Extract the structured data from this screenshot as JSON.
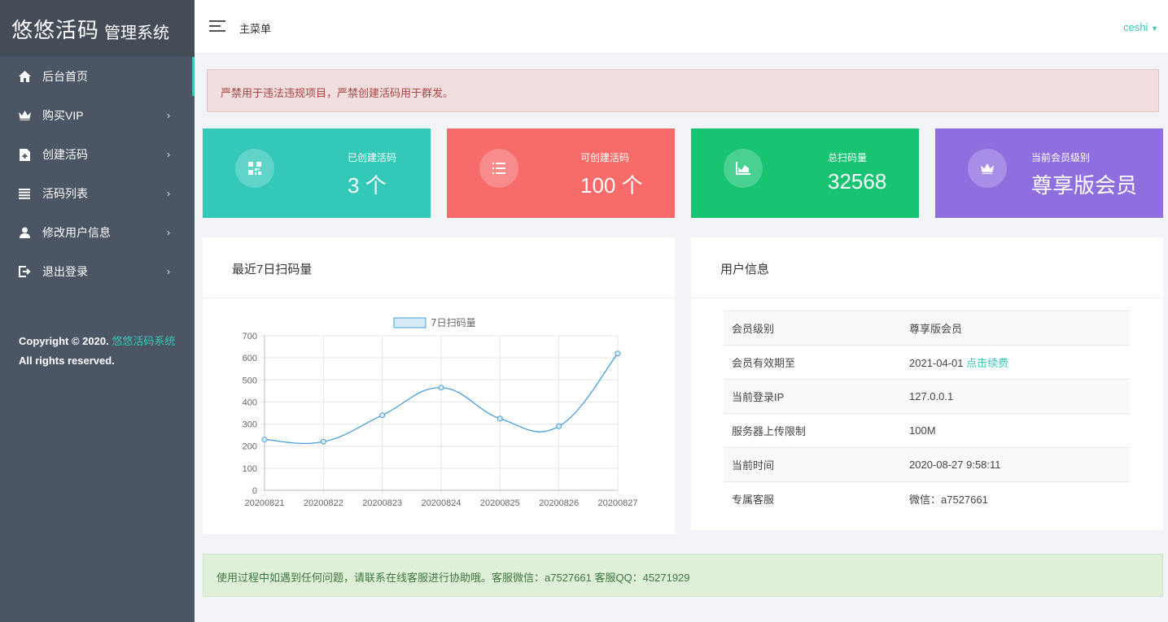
{
  "brand": {
    "name": "悠悠活码",
    "suffix": "管理系统"
  },
  "sidebar": {
    "items": [
      {
        "label": "后台首页",
        "icon": "home-icon"
      },
      {
        "label": "购买VIP",
        "icon": "crown-icon"
      },
      {
        "label": "创建活码",
        "icon": "file-plus-icon"
      },
      {
        "label": "活码列表",
        "icon": "list-icon"
      },
      {
        "label": "修改用户信息",
        "icon": "user-icon"
      },
      {
        "label": "退出登录",
        "icon": "logout-icon"
      }
    ],
    "copyright_prefix": "Copyright © 2020.",
    "copyright_link": "悠悠活码系统",
    "rights": "All rights reserved."
  },
  "header": {
    "title": "主菜单",
    "user": "ceshi"
  },
  "alert_warning": "严禁用于违法违规项目，严禁创建活码用于群发。",
  "alert_info": "使用过程中如遇到任何问题，请联系在线客服进行协助哦。客服微信：a7527661 客服QQ：45271929",
  "stats": [
    {
      "label": "已创建活码",
      "value": "3 个",
      "icon": "qrcode-icon",
      "color": "#34c8b9"
    },
    {
      "label": "可创建活码",
      "value": "100 个",
      "icon": "list-icon",
      "color": "#f76b6b"
    },
    {
      "label": "总扫码量",
      "value": "32568",
      "icon": "area-chart-icon",
      "color": "#18c472"
    },
    {
      "label": "当前会员级别",
      "value": "尊享版会员",
      "icon": "crown-icon",
      "color": "#8f6fe0"
    }
  ],
  "chart_panel": {
    "title": "最近7日扫码量"
  },
  "chart_data": {
    "type": "line",
    "categories": [
      "20200821",
      "20200822",
      "20200823",
      "20200824",
      "20200825",
      "20200826",
      "20200827"
    ],
    "series": [
      {
        "name": "7日扫码量",
        "values": [
          230,
          220,
          340,
          465,
          325,
          290,
          620
        ]
      }
    ],
    "ylim": [
      0,
      700
    ],
    "yticks": [
      0,
      100,
      200,
      300,
      400,
      500,
      600,
      700
    ],
    "grid": true,
    "legend": "top-center",
    "line_color": "#4a9fd8"
  },
  "info_panel": {
    "title": "用户信息",
    "rows": [
      {
        "key": "会员级别",
        "value": "尊享版会员"
      },
      {
        "key": "会员有效期至",
        "value": "2021-04-01",
        "link": "点击续费"
      },
      {
        "key": "当前登录IP",
        "value": "127.0.0.1"
      },
      {
        "key": "服务器上传限制",
        "value": "100M"
      },
      {
        "key": "当前时间",
        "value": "2020-08-27 9:58:11"
      },
      {
        "key": "专属客服",
        "value": "微信：a7527661"
      }
    ]
  }
}
